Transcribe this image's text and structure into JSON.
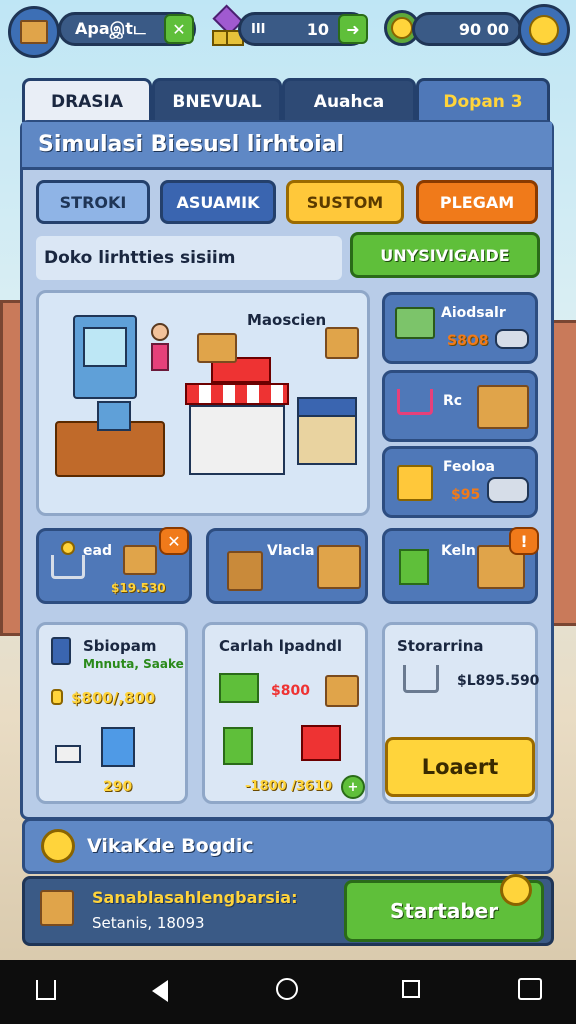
{
  "topbar": {
    "resource1_value": "Apaஇtட",
    "resource2_label": "III",
    "resource2_value": "10",
    "resource3_value": "90 00"
  },
  "tabs": [
    {
      "label": "DRASIA"
    },
    {
      "label": "BNEVUAL"
    },
    {
      "label": "Auahca"
    },
    {
      "label": "Dopan 3"
    }
  ],
  "header": {
    "title": "Simulasi Biesusl lirhtoial"
  },
  "category_buttons": [
    {
      "label": "STROKI"
    },
    {
      "label": "ASUAMIK"
    },
    {
      "label": "SUSTOM"
    },
    {
      "label": "PLEGAM"
    }
  ],
  "subheader": {
    "text": "Doko lirhtties sisiim",
    "action_label": "UNYSIVIGAIDE"
  },
  "scene": {
    "label": "Maoscien"
  },
  "side_items": [
    {
      "name": "Aiodsalr",
      "price": "S8O8"
    },
    {
      "name": "Rc",
      "price": ""
    },
    {
      "name": "Feoloa",
      "price": "$95"
    }
  ],
  "middle_cards": [
    {
      "name": "ead",
      "price": "$19.530"
    },
    {
      "name": "Vlacla",
      "price": ""
    },
    {
      "name": "Keln",
      "price": ""
    }
  ],
  "info_cards": [
    {
      "title": "Sbiopam",
      "subtitle": "Mnnuta, Saake",
      "value": "$800/,800",
      "count": "290"
    },
    {
      "title": "Carlah lpadndl",
      "value": "$800",
      "value2": "-1800 /3610"
    },
    {
      "title": "Storarrina",
      "value": "$L895.590",
      "button_label": "Loaert"
    }
  ],
  "banner": {
    "text": "VikaKde Bogdic"
  },
  "footer": {
    "title": "Sanablasahlengbarsia:",
    "subtitle": "Setanis, 18093",
    "button_label": "Startaber"
  },
  "colors": {
    "accent_yellow": "#ffd43b",
    "accent_green": "#5fbf3a",
    "accent_orange": "#f07a1a",
    "panel_blue": "#6e95cc"
  }
}
